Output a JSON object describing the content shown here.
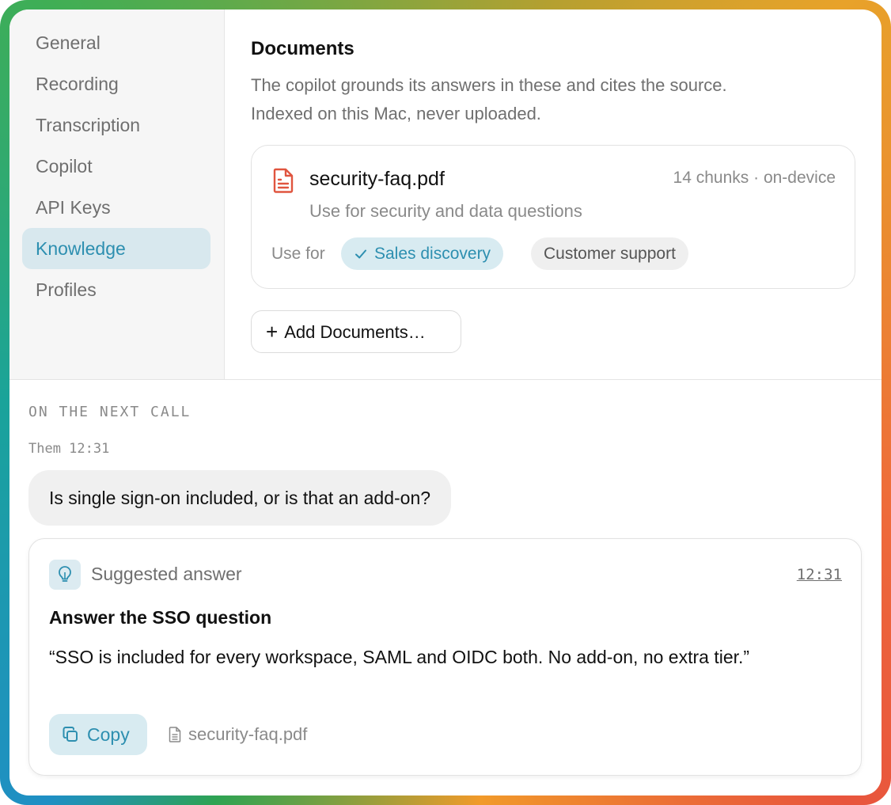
{
  "sidebar": {
    "items": [
      {
        "label": "General"
      },
      {
        "label": "Recording"
      },
      {
        "label": "Transcription"
      },
      {
        "label": "Copilot"
      },
      {
        "label": "API Keys"
      },
      {
        "label": "Knowledge",
        "active": true
      },
      {
        "label": "Profiles"
      }
    ]
  },
  "documents": {
    "title": "Documents",
    "description_line1": "The copilot grounds its answers in these and cites the source.",
    "description_line2": "Indexed on this Mac, never uploaded.",
    "file": {
      "icon": "pdf-file-icon",
      "name": "security-faq.pdf",
      "meta": "14 chunks · on-device",
      "note": "Use for security and data questions",
      "use_for_label": "Use for",
      "tags": [
        {
          "label": "Sales discovery",
          "selected": true
        },
        {
          "label": "Customer support",
          "selected": false
        }
      ]
    },
    "add_button": "Add Documents…"
  },
  "next_call": {
    "heading": "ON THE NEXT CALL",
    "speaker": "Them 12:31",
    "question": "Is single sign-on included, or is that an add-on?",
    "suggestion": {
      "icon": "lightbulb-icon",
      "label": "Suggested answer",
      "time": "12:31",
      "title": "Answer the SSO question",
      "text": "“SSO is included for every workspace, SAML and OIDC both. No add-on, no extra tier.”",
      "copy_label": "Copy",
      "source": "security-faq.pdf"
    }
  },
  "colors": {
    "accent": "#2d8fb0",
    "accent_bg": "#d8ebf1",
    "pdf_red": "#e0553f"
  }
}
